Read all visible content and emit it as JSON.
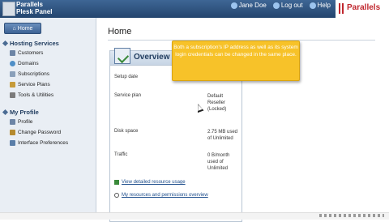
{
  "header": {
    "brand_line1": "Parallels",
    "brand_line2": "Plesk Panel",
    "user_label": "Jane Doe",
    "logout_label": "Log out",
    "help_label": "Help",
    "vendor_logo": "Parallels"
  },
  "sidebar": {
    "home_label": "Home",
    "sections": [
      {
        "title": "Hosting Services",
        "items": [
          "Customers",
          "Domains",
          "Subscriptions",
          "Service Plans",
          "Tools & Utilities"
        ]
      },
      {
        "title": "My Profile",
        "items": [
          "Profile",
          "Change Password",
          "Interface Preferences"
        ]
      }
    ]
  },
  "main": {
    "title": "Home",
    "overview": {
      "title": "Overview",
      "rows": [
        {
          "label": "Setup date",
          "value": ""
        },
        {
          "label": "Service plan",
          "value": "Default Reseller (Locked)"
        },
        {
          "label": "Disk space",
          "value": "2.75 MB used of Unlimited"
        },
        {
          "label": "Traffic",
          "value": "0 B/month used of Unlimited"
        }
      ],
      "links": [
        "View detailed resource usage",
        "My resources and permissions overview"
      ]
    }
  },
  "tooltip": {
    "text": "Both a subscription's IP address as well as its system login credentials can be changed in the same place."
  },
  "colors": {
    "topbar": "#2f5685",
    "tooltip": "#f7c229",
    "accent_red": "#c0262d",
    "link": "#1e4e8c"
  },
  "icons": {
    "home": "home-icon",
    "overview": "overview-icon",
    "cursor": "mouse-pointer-icon"
  }
}
